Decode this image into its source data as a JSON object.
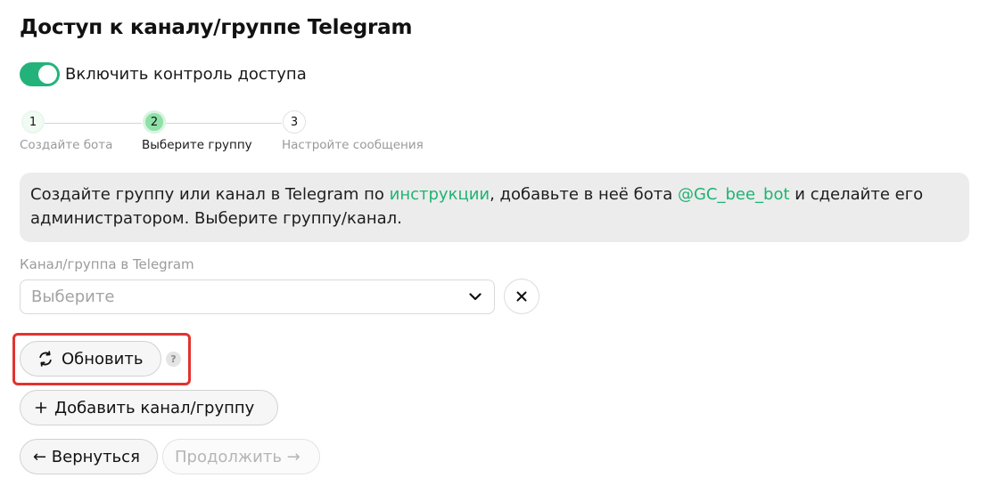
{
  "page": {
    "title": "Доступ к каналу/группе Telegram"
  },
  "access_toggle": {
    "label": "Включить контроль доступа",
    "state": "on",
    "color": "#23b37a"
  },
  "stepper": {
    "steps": [
      {
        "number": "1",
        "label": "Создайте бота",
        "state": "done"
      },
      {
        "number": "2",
        "label": "Выберите группу",
        "state": "current"
      },
      {
        "number": "3",
        "label": "Настройте сообщения",
        "state": "todo"
      }
    ]
  },
  "info": {
    "text_before_link": "Создайте группу или канал в Telegram по ",
    "instructions_link": "инструкции",
    "text_middle": ", добавьте в неё бота ",
    "bot_link": "@GC_bee_bot",
    "text_after": " и сделайте его администратором. Выберите группу/канал.",
    "link_color": "#1fb373"
  },
  "channel_field": {
    "label": "Канал/группа в Telegram",
    "placeholder": "Выберите",
    "dropdown_icon": "chevron-down-icon",
    "clear_icon": "close-icon"
  },
  "buttons": {
    "refresh_label": "Обновить",
    "refresh_icon": "refresh-icon",
    "help_badge": "?",
    "add_label": "Добавить канал/группу",
    "add_icon": "plus-icon",
    "back_label": "← Вернуться",
    "next_label": "Продолжить →"
  },
  "highlight": {
    "color": "#e2332f",
    "target": "refresh-button"
  }
}
